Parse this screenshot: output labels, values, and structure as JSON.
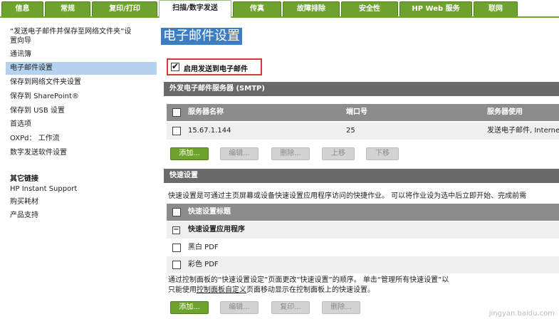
{
  "tabs": [
    "信息",
    "常规",
    "复印/打印",
    "扫描/数字发送",
    "传真",
    "故障排除",
    "安全性",
    "HP Web 服务",
    "联网"
  ],
  "sidebar": {
    "items": [
      "“发送电子邮件并保存至网络文件夹”设",
      "置向导",
      "通讯簿",
      "电子邮件设置",
      "保存到网络文件夹设置",
      "保存到 SharePoint®",
      "保存到 USB 设置",
      "首选项",
      "OXPd： 工作流",
      "数字发送软件设置"
    ],
    "other_links_title": "其它链接",
    "other_links": [
      "HP Instant Support",
      "购买耗材",
      "产品支持"
    ]
  },
  "main": {
    "title": "电子邮件设置",
    "enable_label": "启用发送到电子邮件",
    "smtp_section": "外发电子邮件服务器 (SMTP)",
    "smtp_columns": [
      "服务器名称",
      "端口号",
      "服务器使用"
    ],
    "smtp_rows": [
      {
        "server": "15.67.1.144",
        "port": "25",
        "usage": "发送电子邮件, Interne"
      }
    ],
    "smtp_buttons": [
      "添加...",
      "编辑...",
      "删除...",
      "上移",
      "下移"
    ],
    "quick_section": "快速设置",
    "quick_desc": "快速设置是可通过主页屏幕或设备快速设置应用程序访问的快捷作业。 可以将作业设为选中后立即开始、完成前需",
    "quick_header": "快速设置标题",
    "quick_group": "快速设置应用程序",
    "quick_items": [
      "黑白 PDF",
      "彩色 PDF"
    ],
    "footer_line1": "通过控制面板的“快速设置设定”页面更改“快速设置”的顺序。 单击“管理所有快速设置”以",
    "footer_line2_prefix": "只能使用",
    "footer_line2_link": "控制面板自定义",
    "footer_line2_suffix": "页面移动显示在控制面板上的快速设置。",
    "quick_buttons": [
      "添加...",
      "编辑...",
      "复印...",
      "删除..."
    ]
  },
  "watermark": "jingyan.baidu.com",
  "colors": {
    "tab_green": "#6ea42e",
    "title_blue": "#3b7ec4",
    "selected_bg": "#b4d1ee",
    "section_gray": "#6a6a6a",
    "highlight_red": "#d63b3b"
  }
}
